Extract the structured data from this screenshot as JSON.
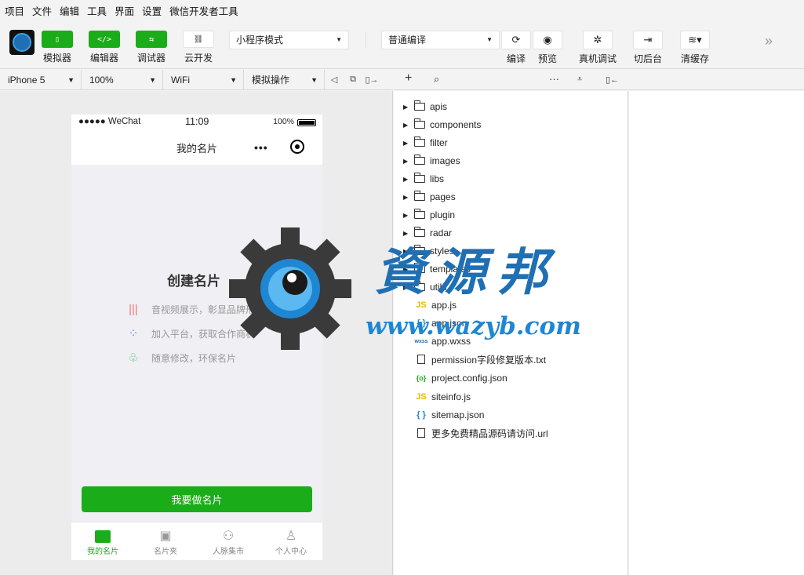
{
  "menu": [
    "项目",
    "文件",
    "编辑",
    "工具",
    "界面",
    "设置",
    "微信开发者工具"
  ],
  "toolbar": {
    "simulator": "模拟器",
    "editor": "编辑器",
    "debugger": "调试器",
    "cloud": "云开发",
    "mode_select": "小程序模式",
    "compile_select": "普通编译",
    "compile": "编译",
    "preview": "预览",
    "real_debug": "真机调试",
    "background": "切后台",
    "clear_cache": "清缓存"
  },
  "device_bar": {
    "device": "iPhone 5",
    "zoom": "100%",
    "network": "WiFi",
    "operation": "模拟操作"
  },
  "phone": {
    "status_left": "●●●●● WeChat",
    "status_time": "11:09",
    "status_battery": "100%",
    "nav_title": "我的名片",
    "create_title": "创建名片",
    "features": [
      {
        "icon": "audio-wave-icon",
        "text": "音视频展示，彰显品牌形象"
      },
      {
        "icon": "platform-dots-icon",
        "text": "加入平台，获取合作商机"
      },
      {
        "icon": "sprout-icon",
        "text": "随意修改，环保名片"
      }
    ],
    "make_button": "我要做名片",
    "tabs": [
      {
        "label": "我的名片",
        "active": true
      },
      {
        "label": "名片夹",
        "active": false
      },
      {
        "label": "人脉集市",
        "active": false
      },
      {
        "label": "个人中心",
        "active": false
      }
    ]
  },
  "explorer": {
    "folders": [
      "apis",
      "components",
      "filter",
      "images",
      "libs",
      "pages",
      "plugin",
      "radar",
      "styles",
      "templates",
      "utils"
    ],
    "files": [
      {
        "type": "js",
        "badge": "JS",
        "name": "app.js"
      },
      {
        "type": "json",
        "badge": "{ }",
        "name": "app.json"
      },
      {
        "type": "wxss",
        "badge": "wxss",
        "name": "app.wxss"
      },
      {
        "type": "txt",
        "badge": "",
        "name": "permission字段修复版本.txt"
      },
      {
        "type": "cfg",
        "badge": "{o}",
        "name": "project.config.json"
      },
      {
        "type": "js",
        "badge": "JS",
        "name": "siteinfo.js"
      },
      {
        "type": "json",
        "badge": "{ }",
        "name": "sitemap.json"
      },
      {
        "type": "url",
        "badge": "",
        "name": "更多免费精品源码请访问.url"
      }
    ]
  },
  "watermark": {
    "title": "資源邦",
    "url": "www.wazyb.com"
  },
  "colors": {
    "accent": "#1aad19",
    "watermark_blue": "#1f6fb3"
  }
}
